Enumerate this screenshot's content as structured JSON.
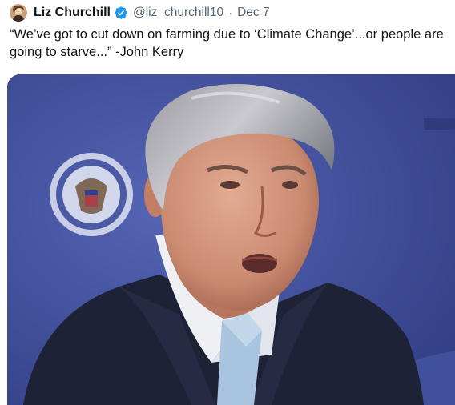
{
  "author": {
    "display_name": "Liz Churchill",
    "handle": "@liz_churchill10",
    "verified": true,
    "avatar_icon": "user-avatar"
  },
  "tweet": {
    "separator": "·",
    "date": "Dec 7",
    "text": "“We’ve got to cut down on farming due to ‘Climate Change’...or people are going to starve...” -John Kerry"
  },
  "media": {
    "kind": "photo",
    "subject": "man in dark suit and light blue tie speaking",
    "background_color": "#3f4f9c",
    "suit_color": "#1e2236",
    "tie_color": "#a9c4de"
  },
  "colors": {
    "text_primary": "#0f1419",
    "text_secondary": "#536471",
    "verified_blue": "#1d9bf0"
  }
}
